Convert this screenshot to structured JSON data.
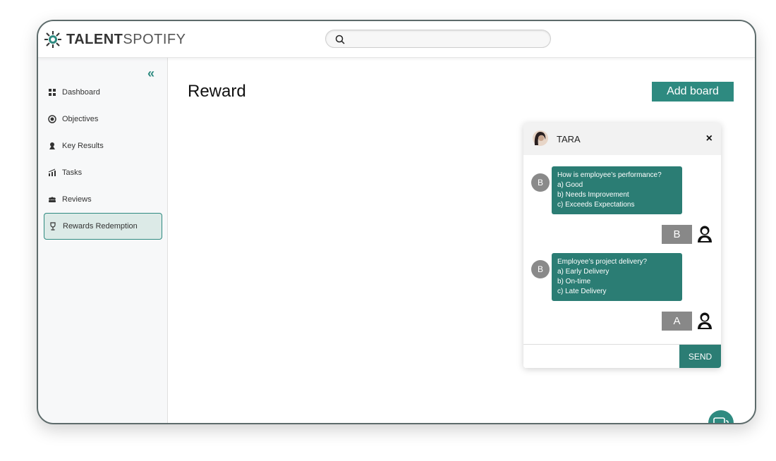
{
  "header": {
    "logo_bold": "TALENT",
    "logo_light": "SPOTIFY",
    "search_placeholder": ""
  },
  "sidebar": {
    "items": [
      {
        "label": "Dashboard",
        "icon": "grid-icon"
      },
      {
        "label": "Objectives",
        "icon": "target-icon"
      },
      {
        "label": "Key Results",
        "icon": "key-results-icon"
      },
      {
        "label": "Tasks",
        "icon": "tasks-icon"
      },
      {
        "label": "Reviews",
        "icon": "reviews-icon"
      },
      {
        "label": "Rewards Redemption",
        "icon": "trophy-icon",
        "active": true
      }
    ]
  },
  "main": {
    "title": "Reward",
    "add_board_label": "Add board"
  },
  "chat": {
    "name": "TARA",
    "close": "×",
    "messages": [
      {
        "avatar": "B",
        "lines": [
          "How is employee’s  performance?",
          "a) Good",
          "b) Needs Improvement",
          "c) Exceeds Expectations"
        ],
        "answer": "B"
      },
      {
        "avatar": "B",
        "lines": [
          "Employee’s  project delivery?",
          "a) Early Delivery",
          "b) On-time",
          "c) Late Delivery"
        ],
        "answer": "A"
      }
    ],
    "input_placeholder": "",
    "send_label": "SEND"
  },
  "colors": {
    "accent": "#2e8a80",
    "bubble": "#2b7d74",
    "answer_box": "#888888"
  }
}
